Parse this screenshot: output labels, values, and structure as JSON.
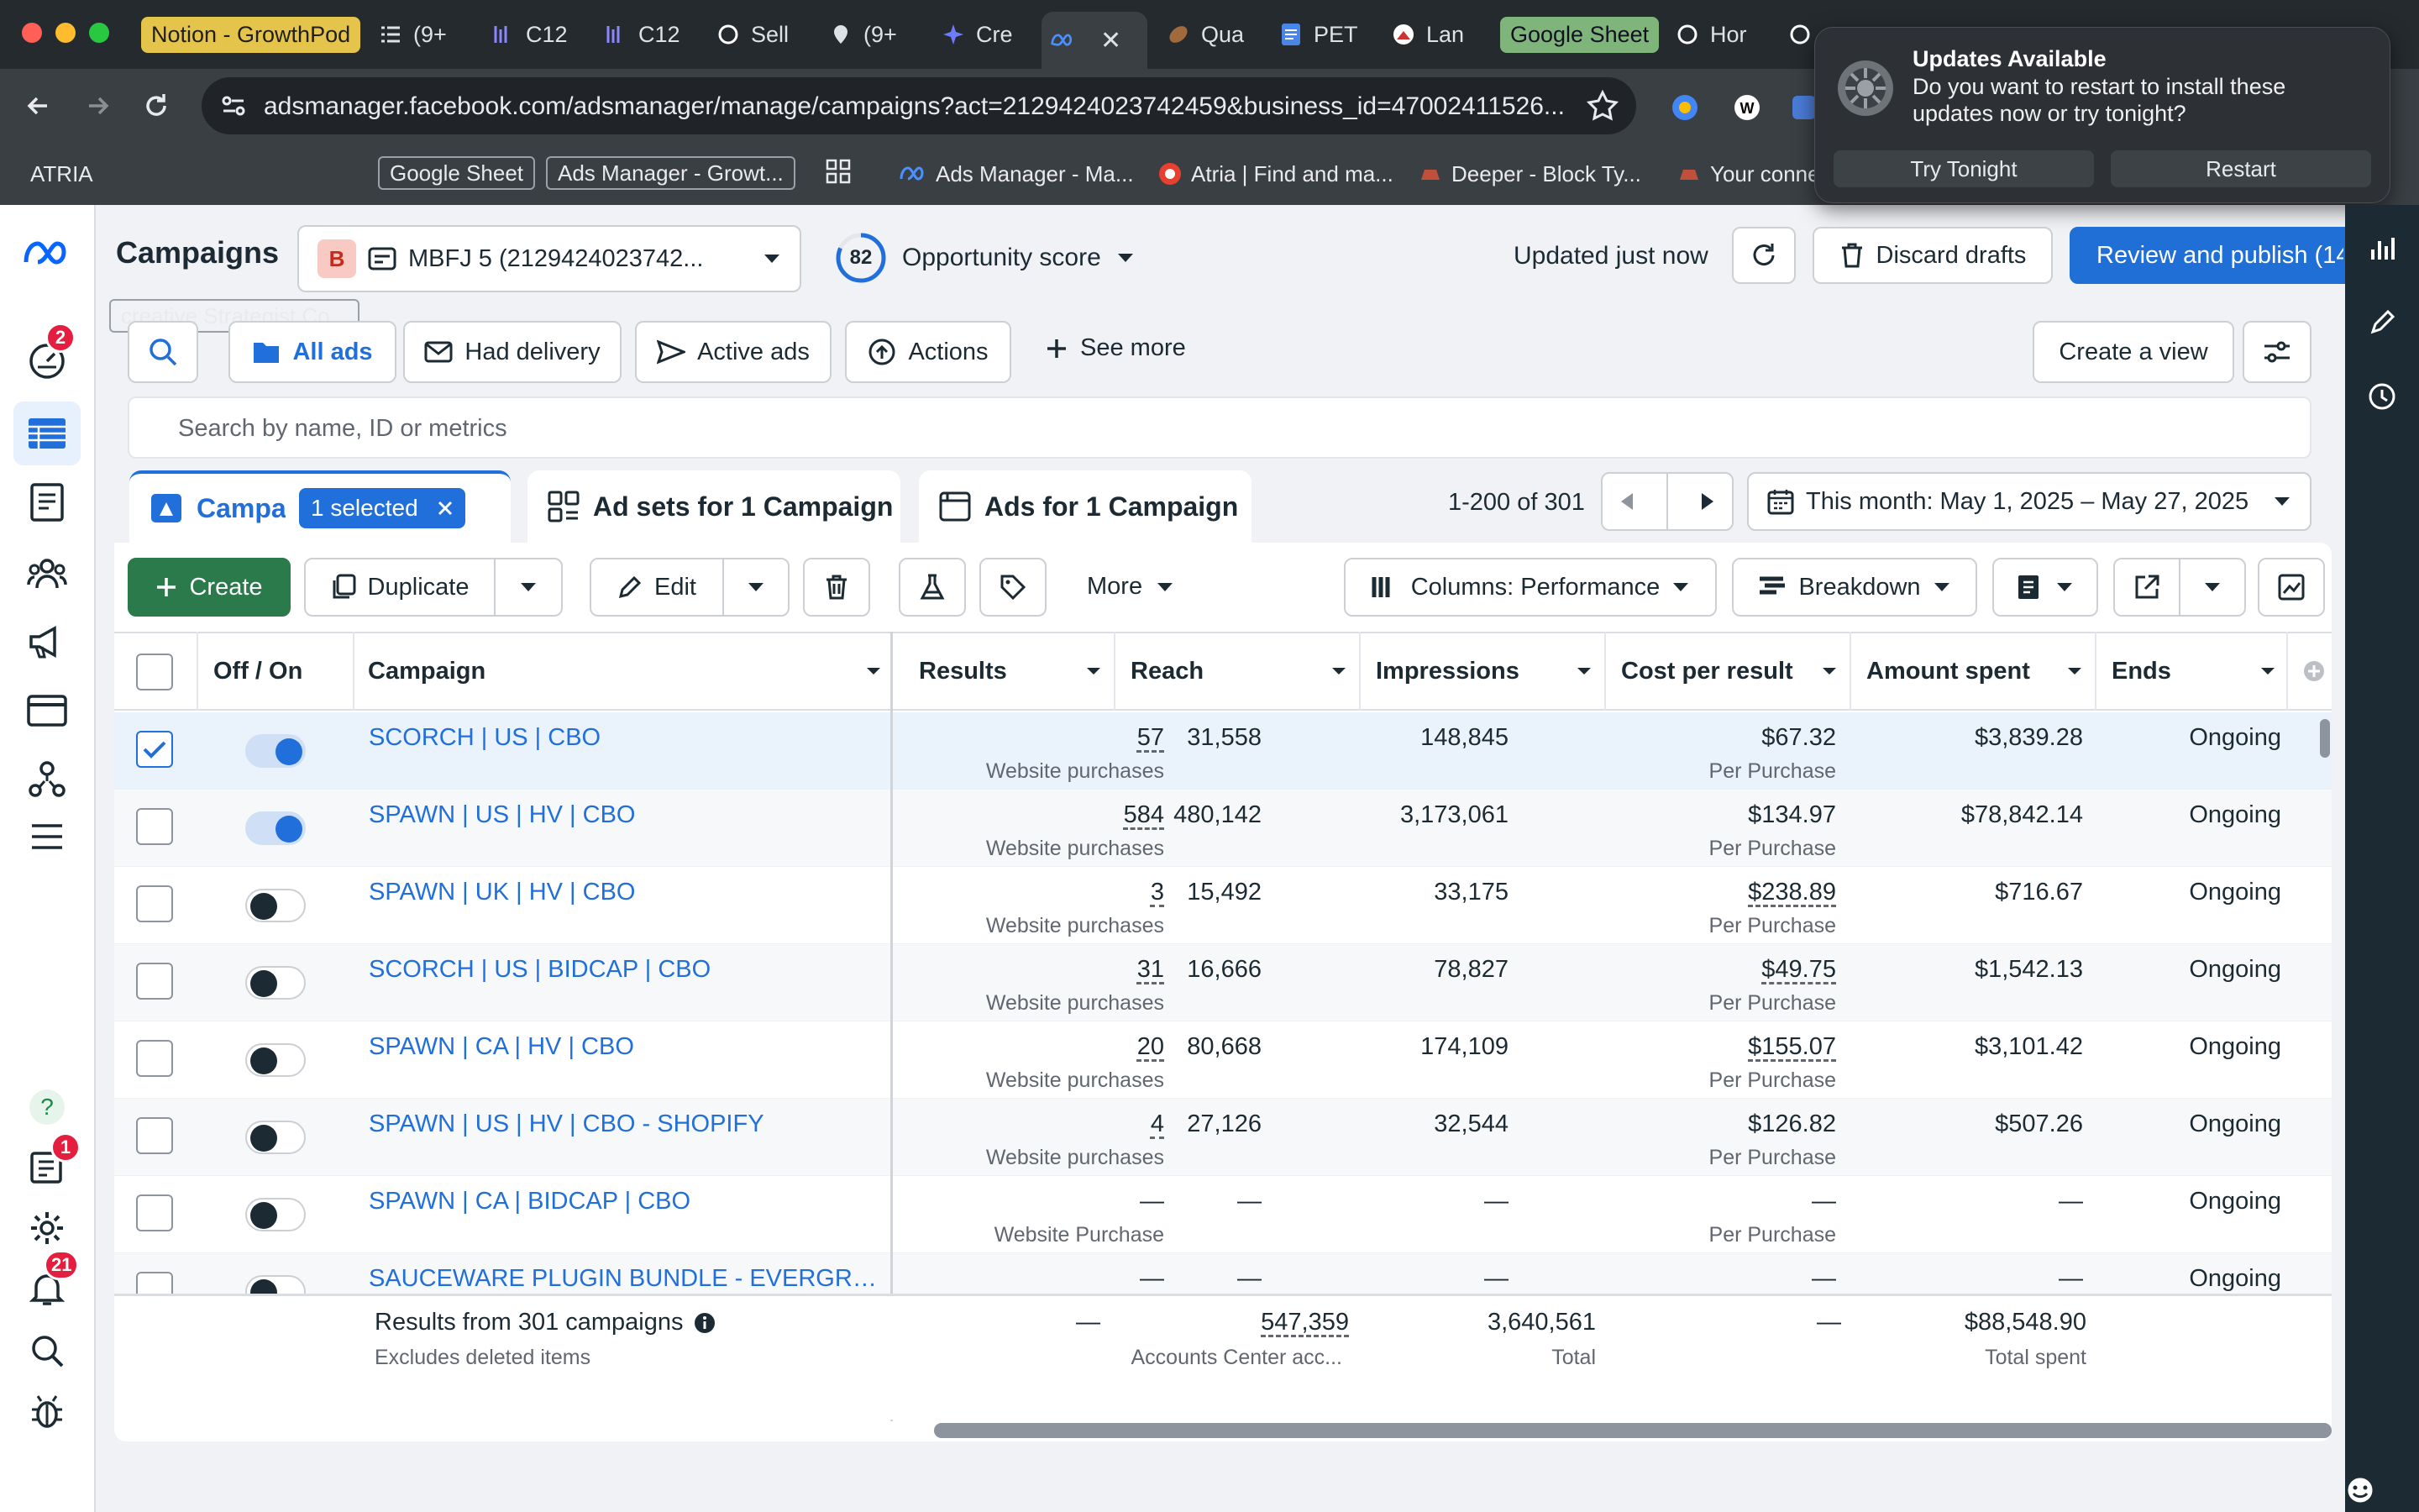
{
  "browser": {
    "tabs": [
      {
        "label": "Notion - GrowthPod",
        "style": "pill"
      },
      {
        "label": "(9+"
      },
      {
        "label": "C12"
      },
      {
        "label": "C12"
      },
      {
        "label": "Sell"
      },
      {
        "label": "(9+"
      },
      {
        "label": "Cre"
      },
      {
        "label": "",
        "active": true
      },
      {
        "label": "Qua"
      },
      {
        "label": "PET"
      },
      {
        "label": "Lan"
      },
      {
        "label": "Google Sheet",
        "style": "pill-green"
      },
      {
        "label": "Hor"
      }
    ],
    "url": "adsmanager.facebook.com/adsmanager/manage/campaigns?act=2129424023742459&business_id=47002411526...",
    "bookmarks": [
      {
        "label": "ATRIA"
      },
      {
        "label": "creative Strategist Co...",
        "boxed": true
      },
      {
        "label": "Google Sheet",
        "boxed": true
      },
      {
        "label": "Ads Manager - Growt...",
        "boxed": true
      },
      {
        "label": "Ads Manager - Ma..."
      },
      {
        "label": "Atria | Find and ma..."
      },
      {
        "label": "Deeper - Block Ty..."
      },
      {
        "label": "Your conne"
      }
    ]
  },
  "notification": {
    "title": "Updates Available",
    "message": "Do you want to restart to install these updates now or try tonight?",
    "try_tonight": "Try Tonight",
    "restart": "Restart"
  },
  "nav": {
    "badge_alerts": "2",
    "badge_news": "1",
    "badge_notifications": "21"
  },
  "header": {
    "title": "Campaigns",
    "account_initial": "B",
    "account_name": "MBFJ 5 (2129424023742...",
    "opportunity_value": "82",
    "opportunity_label": "Opportunity score",
    "updated": "Updated just now",
    "discard": "Discard drafts",
    "publish": "Review and publish (14"
  },
  "filters": {
    "all_ads": "All ads",
    "had_delivery": "Had delivery",
    "active_ads": "Active ads",
    "actions": "Actions",
    "see_more": "See more",
    "create_view": "Create a view",
    "search_placeholder": "Search by name, ID or metrics"
  },
  "level_tabs": {
    "campaigns": "Campai",
    "selected": "1 selected",
    "ad_sets": "Ad sets for 1 Campaign",
    "ads": "Ads for 1 Campaign"
  },
  "pagination": {
    "range": "1-200 of 301",
    "date_range": "This month: May 1, 2025 – May 27, 2025"
  },
  "toolbar": {
    "create": "Create",
    "duplicate": "Duplicate",
    "edit": "Edit",
    "more": "More",
    "columns": "Columns: Performance",
    "breakdown": "Breakdown"
  },
  "table": {
    "columns": [
      "Off / On",
      "Campaign",
      "Results",
      "Reach",
      "Impressions",
      "Cost per result",
      "Amount spent",
      "Ends"
    ],
    "rows": [
      {
        "checked": true,
        "on": true,
        "campaign": "SCORCH | US | CBO",
        "results": "57",
        "results_type": "Website purchases",
        "reach": "31,558",
        "impressions": "148,845",
        "cpr": "$67.32",
        "cpr_type": "Per Purchase",
        "spent": "$3,839.28",
        "ends": "Ongoing"
      },
      {
        "checked": false,
        "on": true,
        "campaign": "SPAWN | US | HV | CBO",
        "results": "584",
        "results_type": "Website purchases",
        "reach": "480,142",
        "impressions": "3,173,061",
        "cpr": "$134.97",
        "cpr_type": "Per Purchase",
        "spent": "$78,842.14",
        "ends": "Ongoing"
      },
      {
        "checked": false,
        "on": false,
        "campaign": "SPAWN | UK | HV | CBO",
        "results": "3",
        "results_type": "Website purchases",
        "reach": "15,492",
        "impressions": "33,175",
        "cpr": "$238.89",
        "cpr_type": "Per Purchase",
        "spent": "$716.67",
        "ends": "Ongoing"
      },
      {
        "checked": false,
        "on": false,
        "campaign": "SCORCH | US | BIDCAP | CBO",
        "results": "31",
        "results_type": "Website purchases",
        "reach": "16,666",
        "impressions": "78,827",
        "cpr": "$49.75",
        "cpr_type": "Per Purchase",
        "spent": "$1,542.13",
        "ends": "Ongoing"
      },
      {
        "checked": false,
        "on": false,
        "campaign": "SPAWN | CA | HV | CBO",
        "results": "20",
        "results_type": "Website purchases",
        "reach": "80,668",
        "impressions": "174,109",
        "cpr": "$155.07",
        "cpr_type": "Per Purchase",
        "spent": "$3,101.42",
        "ends": "Ongoing"
      },
      {
        "checked": false,
        "on": false,
        "campaign": "SPAWN | US | HV | CBO - SHOPIFY",
        "results": "4",
        "results_type": "Website purchases",
        "reach": "27,126",
        "impressions": "32,544",
        "cpr": "$126.82",
        "cpr_type": "Per Purchase",
        "spent": "$507.26",
        "ends": "Ongoing"
      },
      {
        "checked": false,
        "on": false,
        "campaign": "SPAWN | CA | BIDCAP | CBO",
        "results": "—",
        "results_type": "Website Purchase",
        "reach": "—",
        "impressions": "—",
        "cpr": "—",
        "cpr_type": "Per Purchase",
        "spent": "—",
        "ends": "Ongoing"
      },
      {
        "checked": false,
        "on": false,
        "campaign": "SAUCEWARE PLUGIN BUNDLE - EVERGREE...",
        "results": "—",
        "results_type": "",
        "reach": "—",
        "impressions": "—",
        "cpr": "—",
        "cpr_type": "",
        "spent": "—",
        "ends": "Ongoing"
      }
    ],
    "footer": {
      "label": "Results from 301 campaigns",
      "sublabel": "Excludes deleted items",
      "results": "—",
      "reach": "547,359",
      "reach_sub": "Accounts Center acc...",
      "impressions": "3,640,561",
      "impressions_sub": "Total",
      "cpr": "—",
      "spent": "$88,548.90",
      "spent_sub": "Total spent"
    }
  },
  "colors": {
    "primary_blue": "#216fdb",
    "create_green": "#2b7a4b",
    "publish_blue": "#1f6fd6",
    "text": "#1c2b33"
  }
}
